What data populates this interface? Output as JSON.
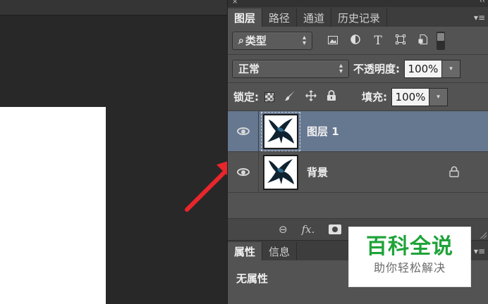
{
  "panel": {
    "close_glyph": "×",
    "collapse_glyph": "‹‹",
    "tabs": [
      {
        "label": "图层"
      },
      {
        "label": "路径"
      },
      {
        "label": "通道"
      },
      {
        "label": "历史记录"
      }
    ],
    "tab_menu_glyph": "▾≡"
  },
  "filter": {
    "kind_label": "类型",
    "search_glyph": "⌕",
    "icons": [
      "image-filter-icon",
      "adjustment-filter-icon",
      "type-filter-icon",
      "shape-filter-icon",
      "smart-object-filter-icon"
    ],
    "type_glyph": "T"
  },
  "blend": {
    "mode": "正常",
    "opacity_label": "不透明度:",
    "opacity_value": "100%"
  },
  "lock": {
    "label": "锁定:",
    "fill_label": "填充:",
    "fill_value": "100%"
  },
  "layers": [
    {
      "name": "图层 1",
      "selected": true,
      "locked": false
    },
    {
      "name": "背景",
      "selected": false,
      "locked": true
    }
  ],
  "footer": {
    "link_glyph": "⊖",
    "fx_label": "fx."
  },
  "properties": {
    "tabs": [
      {
        "label": "属性"
      },
      {
        "label": "信息"
      }
    ],
    "empty_text": "无属性"
  },
  "watermark": {
    "title": "百科全说",
    "subtitle": "助你轻松解决"
  },
  "colors": {
    "selection": "#667790",
    "arrow": "#e8262b",
    "watermark_green": "#1fa339"
  }
}
